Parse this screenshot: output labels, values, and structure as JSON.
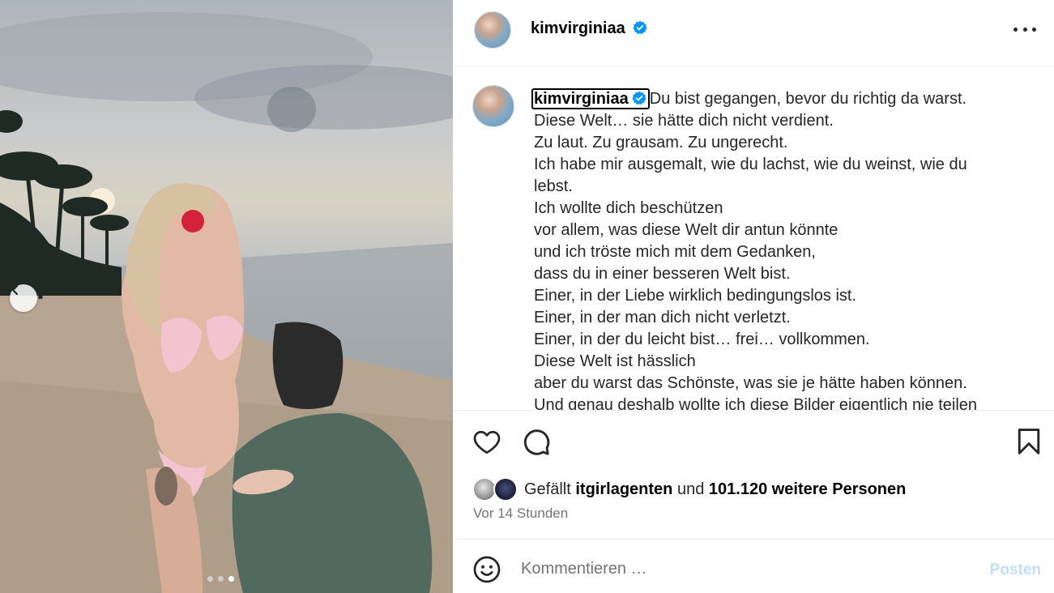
{
  "post": {
    "username": "kimvirginiaa",
    "verified": true,
    "caption_lines": [
      "Du bist gegangen, bevor du richtig da warst.",
      "Diese Welt… sie hätte dich nicht verdient.",
      "Zu laut. Zu grausam. Zu ungerecht.",
      "Ich habe mir ausgemalt, wie du lachst, wie du weinst, wie du",
      "lebst.",
      "Ich wollte dich beschützen",
      "vor allem, was diese Welt dir antun könnte",
      "und ich tröste mich mit dem Gedanken,",
      "dass du in einer besseren Welt bist.",
      "Einer, in der Liebe wirklich bedingungslos ist.",
      "Einer, in der man dich nicht verletzt.",
      "Einer, in der du leicht bist… frei… vollkommen.",
      "Diese Welt ist hässlich",
      "aber du warst das Schönste, was sie je hätte haben können.",
      "Und genau deshalb wollte ich diese Bilder eigentlich nie teilen"
    ]
  },
  "carousel": {
    "total": 3,
    "active_index": 2
  },
  "likes": {
    "prefix": "Gefällt",
    "first_user": "itgirlagenten",
    "connector": "und",
    "others": "101.120 weitere Personen"
  },
  "timestamp": "Vor 14 Stunden",
  "comment": {
    "placeholder": "Kommentieren …",
    "post_label": "Posten"
  },
  "colors": {
    "verified": "#0095f6",
    "post_disabled": "#c0dffd",
    "muted_text": "#737373"
  },
  "icons": [
    "chevron-left-icon",
    "more-icon",
    "verified-badge-icon",
    "heart-icon",
    "comment-icon",
    "bookmark-icon",
    "emoji-icon"
  ]
}
